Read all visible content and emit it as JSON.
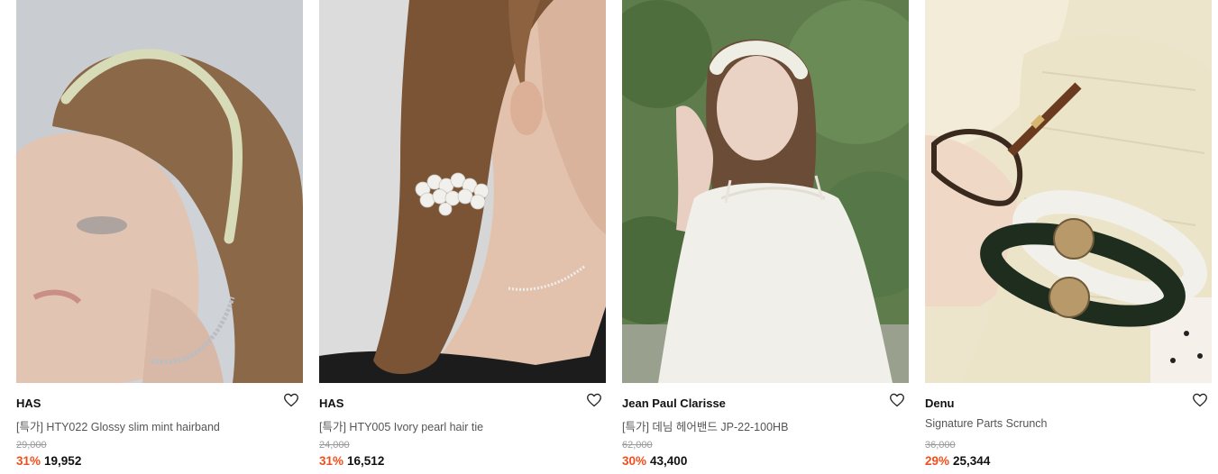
{
  "products": [
    {
      "brand": "HAS",
      "name": "[특가] HTY022 Glossy slim mint hairband",
      "original_price": "29,000",
      "discount": "31%",
      "price": "19,952",
      "image": "model-wearing-mint-hairband"
    },
    {
      "brand": "HAS",
      "name": "[특가] HTY005 Ivory pearl hair tie",
      "original_price": "24,000",
      "discount": "31%",
      "price": "16,512",
      "image": "model-wearing-pearl-hair-tie"
    },
    {
      "brand": "Jean Paul Clarisse",
      "name": "[특가] 데님 헤어밴드 JP-22-100HB",
      "original_price": "62,000",
      "discount": "30%",
      "price": "43,400",
      "image": "model-wearing-ivory-knot-headband"
    },
    {
      "brand": "Denu",
      "name": "Signature Parts Scrunch",
      "original_price": "36,000",
      "discount": "29%",
      "price": "25,344",
      "image": "scrunchies-on-wrist"
    }
  ],
  "icons": {
    "wishlist": "heart-outline-icon"
  },
  "colors": {
    "discount": "#f04e1c",
    "price": "#111111",
    "original_price": "#9a9a9a",
    "name": "#555555"
  }
}
